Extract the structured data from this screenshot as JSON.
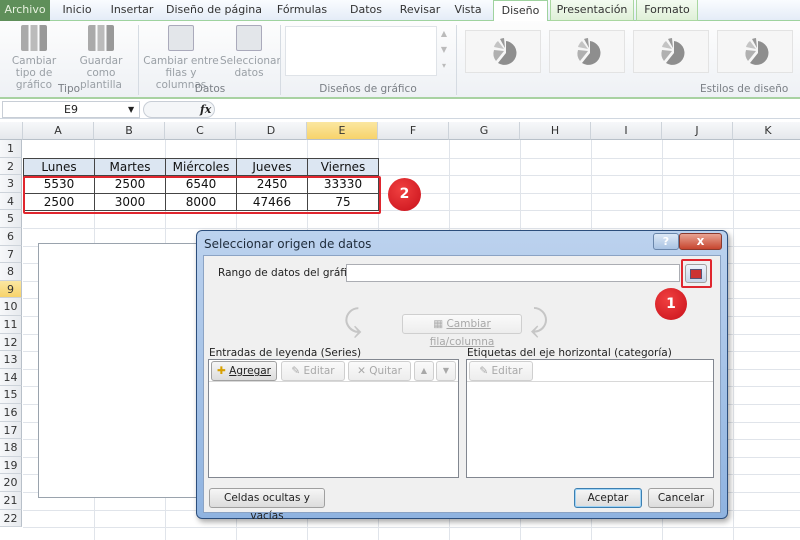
{
  "ribbon_tabs": [
    "Archivo",
    "Inicio",
    "Insertar",
    "Diseño de página",
    "Fórmulas",
    "Datos",
    "Revisar",
    "Vista",
    "Diseño",
    "Presentación",
    "Formato"
  ],
  "active_tab": "Diseño",
  "ribbon": {
    "buttons": [
      {
        "label": "Cambiar tipo de gráfico",
        "icon": "chart-type-icon"
      },
      {
        "label": "Guardar como plantilla",
        "icon": "save-template-icon"
      },
      {
        "label": "Cambiar entre filas y columnas",
        "icon": "switch-row-column-icon"
      },
      {
        "label": "Seleccionar datos",
        "icon": "select-data-icon"
      }
    ],
    "groups": {
      "tipo": "Tipo",
      "datos": "Datos",
      "disenos": "Diseños de gráfico",
      "estilos": "Estilos de diseño"
    },
    "style_icon": "pie-chart-style-icon"
  },
  "formula_bar": {
    "name_box": "E9",
    "fx": "fx",
    "formula": ""
  },
  "sheet": {
    "columns": [
      "A",
      "B",
      "C",
      "D",
      "E",
      "F",
      "G",
      "H",
      "I",
      "J",
      "K"
    ],
    "selected_column": "E",
    "selected_row": 9,
    "rows": 22,
    "table": {
      "headers": [
        "Lunes",
        "Martes",
        "Miércoles",
        "Jueves",
        "Viernes"
      ],
      "rows": [
        [
          "5530",
          "2500",
          "6540",
          "2450",
          "33330"
        ],
        [
          "2500",
          "3000",
          "8000",
          "47466",
          "75"
        ]
      ]
    }
  },
  "annotations": {
    "badge1": "1",
    "badge2": "2",
    "accent": "#e0262e"
  },
  "dialog": {
    "title": "Seleccionar origen de datos",
    "help": "?",
    "close": "x",
    "range_label": "Rango de datos del gráfico:",
    "range_value": "",
    "switch_button": "Cambiar fila/columna",
    "legend_label": "Entradas de leyenda (Series)",
    "legend_buttons": {
      "add": "Agregar",
      "edit": "Editar",
      "remove": "Quitar"
    },
    "axis_label": "Etiquetas del eje horizontal (categoría)",
    "axis_edit": "Editar",
    "hidden_cells": "Celdas ocultas y vacías",
    "ok": "Aceptar",
    "cancel": "Cancelar"
  }
}
